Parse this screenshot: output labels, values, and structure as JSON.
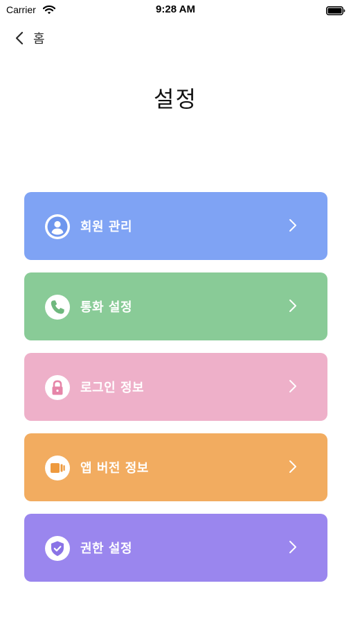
{
  "status_bar": {
    "carrier": "Carrier",
    "time": "9:28 AM"
  },
  "nav": {
    "back_label": "홈"
  },
  "page": {
    "title": "설정"
  },
  "menu": {
    "items": [
      {
        "label": "회원 관리",
        "icon": "user-icon",
        "color": "#7FA3F4"
      },
      {
        "label": "통화 설정",
        "icon": "phone-icon",
        "color": "#89CB97"
      },
      {
        "label": "로그인 정보",
        "icon": "lock-icon",
        "color": "#EEB0C9"
      },
      {
        "label": "앱 버전 정보",
        "icon": "version-icon",
        "color": "#F2AC60"
      },
      {
        "label": "권한 설정",
        "icon": "shield-check-icon",
        "color": "#9A86EE"
      }
    ]
  }
}
